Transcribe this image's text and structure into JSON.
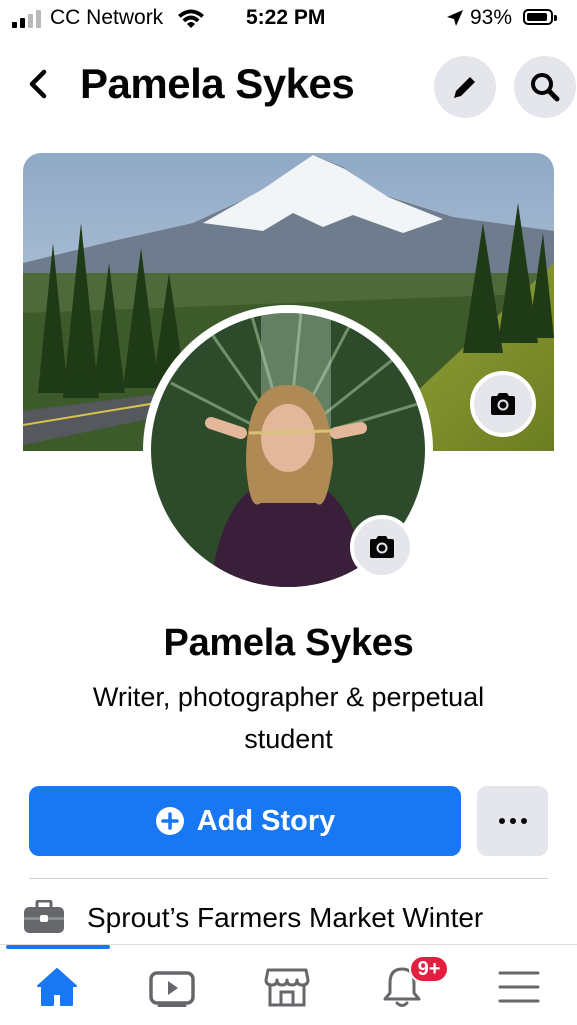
{
  "status_bar": {
    "carrier": "CC Network",
    "time": "5:22 PM",
    "battery_percent": "93%",
    "battery_level": 0.93,
    "icons": [
      "signal-icon",
      "wifi-icon",
      "location-arrow-icon",
      "battery-icon"
    ]
  },
  "header": {
    "title": "Pamela Sykes",
    "icons": [
      "back-chevron-icon",
      "pencil-icon",
      "search-icon"
    ]
  },
  "profile": {
    "name": "Pamela Sykes",
    "bio": "Writer, photographer & perpetual student",
    "cover_icon": "camera-icon",
    "avatar_icon": "camera-icon"
  },
  "actions": {
    "add_story_label": "Add Story",
    "add_story_icon": "plus-circle-icon",
    "more_icon": "ellipsis-icon"
  },
  "details": {
    "work_text": "Sprout’s Farmers Market Winter",
    "work_icon": "briefcase-icon"
  },
  "tab_bar": {
    "tabs": [
      {
        "name": "home",
        "icon": "home-icon",
        "active": true
      },
      {
        "name": "watch",
        "icon": "video-icon",
        "active": false
      },
      {
        "name": "marketplace",
        "icon": "shop-icon",
        "active": false
      },
      {
        "name": "notifications",
        "icon": "bell-icon",
        "active": false
      },
      {
        "name": "menu",
        "icon": "menu-icon",
        "active": false
      }
    ],
    "notifications_badge": "9+"
  },
  "colors": {
    "accent": "#1877f2",
    "badge": "#e41e3f",
    "button_gray": "#e4e6eb"
  }
}
